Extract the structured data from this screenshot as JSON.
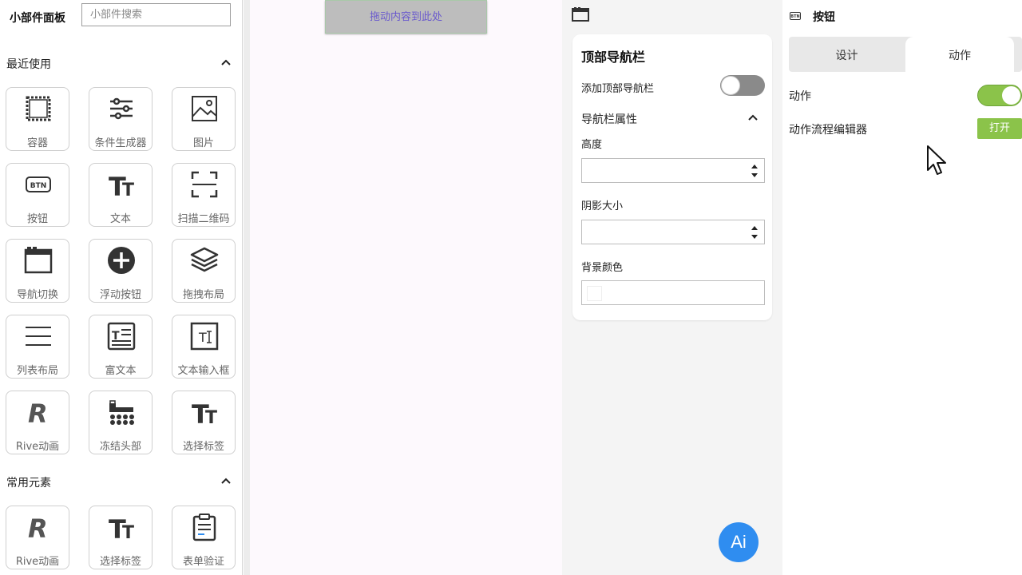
{
  "left_panel": {
    "title": "小部件面板",
    "search_placeholder": "小部件搜索",
    "recent": {
      "label": "最近使用",
      "items": [
        {
          "label": "容器",
          "icon": "container-icon"
        },
        {
          "label": "条件生成器",
          "icon": "sliders-icon"
        },
        {
          "label": "图片",
          "icon": "image-icon"
        },
        {
          "label": "按钮",
          "icon": "btn-icon"
        },
        {
          "label": "文本",
          "icon": "text-icon"
        },
        {
          "label": "扫描二维码",
          "icon": "scan-icon"
        },
        {
          "label": "导航切换",
          "icon": "window-icon"
        },
        {
          "label": "浮动按钮",
          "icon": "plus-circle-icon"
        },
        {
          "label": "拖拽布局",
          "icon": "layers-icon"
        },
        {
          "label": "列表布局",
          "icon": "list-icon"
        },
        {
          "label": "富文本",
          "icon": "richtext-icon"
        },
        {
          "label": "文本输入框",
          "icon": "textfield-icon"
        },
        {
          "label": "Rive动画",
          "icon": "rive-icon"
        },
        {
          "label": "冻结头部",
          "icon": "freeze-header-icon"
        },
        {
          "label": "选择标签",
          "icon": "text-icon"
        }
      ]
    },
    "common": {
      "label": "常用元素",
      "items": [
        {
          "label": "Rive动画",
          "icon": "rive-icon"
        },
        {
          "label": "选择标签",
          "icon": "text-icon"
        },
        {
          "label": "表单验证",
          "icon": "clipboard-icon"
        }
      ]
    }
  },
  "canvas": {
    "dropzone_text": "拖动内容到此处"
  },
  "properties": {
    "title": "顶部导航栏",
    "add_label": "添加顶部导航栏",
    "add_enabled": false,
    "section_label": "导航栏属性",
    "height_label": "高度",
    "height_value": "",
    "shadow_label": "阴影大小",
    "shadow_value": "",
    "bg_color_label": "背景颜色"
  },
  "ai_button": {
    "label": "Ai",
    "color": "#2f8df0"
  },
  "right_panel": {
    "title": "按钮",
    "tabs": [
      "设计",
      "动作"
    ],
    "selected_tab": "动作",
    "action_label": "动作",
    "action_enabled": true,
    "flow_editor_label": "动作流程编辑器",
    "open_button": "打开",
    "accent_color": "#8bc34a"
  }
}
